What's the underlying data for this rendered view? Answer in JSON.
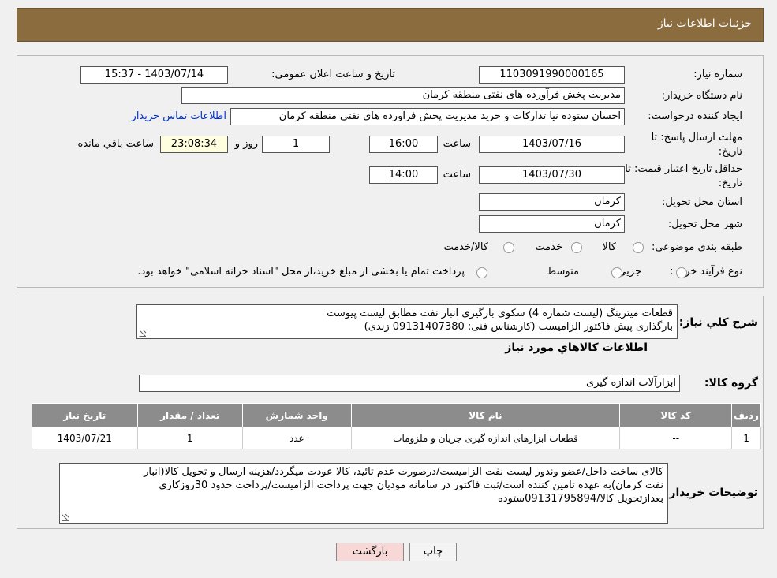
{
  "header": {
    "title": "جزئیات اطلاعات نیاز"
  },
  "need_number": {
    "label": "شماره نیاز:",
    "value": "1103091990000165"
  },
  "announce": {
    "label": "تاریخ و ساعت اعلان عمومی:",
    "value": "1403/07/14 - 15:37"
  },
  "buyer_org": {
    "label": "نام دستگاه خریدار:",
    "value": "مدیریت پخش فرآورده های نفتی منطقه کرمان"
  },
  "requester": {
    "label": "ایجاد کننده درخواست:",
    "value": "احسان  ستوده نیا  تدارکات و خرید  مدیریت پخش فرآورده های نفتی منطقه کرمان",
    "contact_link": "اطلاعات تماس خریدار"
  },
  "deadline": {
    "label_line1": "مهلت ارسال پاسخ: تا",
    "label_line2": "تاریخ:",
    "date": "1403/07/16",
    "time_label": "ساعت",
    "time": "16:00",
    "days": "1",
    "days_label": "روز و",
    "remaining": "23:08:34",
    "remaining_label": "ساعت باقي مانده"
  },
  "validity": {
    "label_line1": "حداقل تاریخ اعتبار قیمت: تا",
    "label_line2": "تاریخ:",
    "date": "1403/07/30",
    "time_label": "ساعت",
    "time": "14:00"
  },
  "province": {
    "label": "استان محل تحویل:",
    "value": "کرمان"
  },
  "city": {
    "label": "شهر محل تحویل:",
    "value": "کرمان"
  },
  "category": {
    "label": "طبقه بندی موضوعی:",
    "options": [
      "کالا",
      "خدمت",
      "کالا/خدمت"
    ]
  },
  "process": {
    "label": "نوع فرآیند خرید :",
    "options": [
      "جزیي",
      "متوسط"
    ],
    "note": "پرداخت تمام یا بخشی از مبلغ خرید،از محل \"اسناد خزانه اسلامی\" خواهد بود."
  },
  "summary": {
    "label": "شرح کلي نياز:",
    "line1": "قطعات میترینگ (لیست شماره 4) سکوی بارگیری انبار نفت مطابق لیست پیوست",
    "line2": "بارگذاری پیش فاکتور الزامیست (کارشناس فنی: 09131407380 زندی)"
  },
  "goods_section": {
    "title": "اطلاعات کالاهاي مورد نياز"
  },
  "goods_group": {
    "label": "گروه کالا:",
    "value": "ابزارآلات اندازه گیری"
  },
  "table": {
    "headers": [
      "رديف",
      "کد کالا",
      "نام کالا",
      "واحد شمارش",
      "تعداد / مقدار",
      "تاریخ نیاز"
    ],
    "rows": [
      [
        "1",
        "--",
        "قطعات ابزارهای اندازه گیری جریان و ملزومات",
        "عدد",
        "1",
        "1403/07/21"
      ]
    ]
  },
  "buyer_notes": {
    "label": "توضیحات خریدار:",
    "line1": "کالای ساخت داخل/عضو وندور لیست نفت الزامیست/درصورت عدم تائید، کالا عودت میگردد/هزینه ارسال و تحویل کالا(انبار",
    "line2": "نفت کرمان)به عهده تامین کننده است/ثبت فاکتور در سامانه مودیان جهت پرداخت الزامیست/پرداخت حدود 30روزکاری",
    "line3": "بعدازتحویل کالا/09131795894ستوده"
  },
  "buttons": {
    "print": "چاپ",
    "back": "بازگشت"
  },
  "colors": {
    "header": "#8b6c3f",
    "table_header": "#8c8c8c",
    "back_button": "#f8d7d7",
    "link": "#0033cc"
  }
}
